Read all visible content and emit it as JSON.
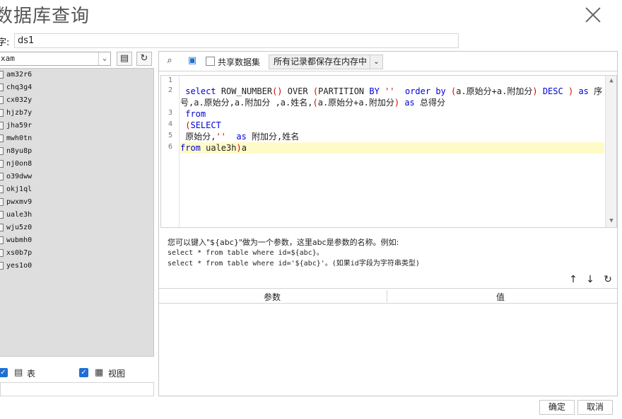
{
  "window": {
    "title": "数据库查询"
  },
  "name_field": {
    "label": "字:",
    "value": "ds1"
  },
  "left": {
    "datasource_value": "xam",
    "tables": [
      "am32r6",
      "chq3g4",
      "cx032y",
      "hjzb7y",
      "jha59r",
      "mwh0tn",
      "n8yu8p",
      "nj0on8",
      "o39dww",
      "okj1ql",
      "pwxmv9",
      "uale3h",
      "wju5z0",
      "wubmh0",
      "xs0b7p",
      "yes1o0"
    ],
    "options": {
      "table_label": "表",
      "view_label": "视图"
    }
  },
  "toolbar": {
    "share_label": "共享数据集",
    "mode_value": "所有记录都保存在内存中"
  },
  "editor": {
    "line_numbers": [
      "1",
      "2",
      "3",
      "4",
      "5",
      "6"
    ],
    "lines": [
      [],
      [
        {
          "t": " "
        },
        {
          "t": "select",
          "c": "kw"
        },
        {
          "t": " ROW_NUMBER"
        },
        {
          "t": "()",
          "c": "pn"
        },
        {
          "t": " OVER "
        },
        {
          "t": "(",
          "c": "pn"
        },
        {
          "t": "PARTITION "
        },
        {
          "t": "BY",
          "c": "kw"
        },
        {
          "t": " "
        },
        {
          "t": "''",
          "c": "pn"
        },
        {
          "t": "  "
        },
        {
          "t": "order by",
          "c": "kw"
        },
        {
          "t": " "
        },
        {
          "t": "(",
          "c": "pn"
        },
        {
          "t": "a.原始分+a.附加分"
        },
        {
          "t": ")",
          "c": "pn"
        },
        {
          "t": " "
        },
        {
          "t": "DESC",
          "c": "kw"
        },
        {
          "t": " "
        },
        {
          "t": ")",
          "c": "pn"
        },
        {
          "t": " "
        },
        {
          "t": "as",
          "c": "kw"
        },
        {
          "t": " 序"
        }
      ],
      [
        {
          "t": "号,a.原始分,a.附加分 ,a.姓名,"
        },
        {
          "t": "(",
          "c": "pn"
        },
        {
          "t": "a.原始分+a.附加分"
        },
        {
          "t": ")",
          "c": "pn"
        },
        {
          "t": " "
        },
        {
          "t": "as",
          "c": "kw"
        },
        {
          "t": " 总得分"
        }
      ],
      [
        {
          "t": " "
        },
        {
          "t": "from",
          "c": "kw"
        }
      ],
      [
        {
          "t": " "
        },
        {
          "t": "(",
          "c": "pn"
        },
        {
          "t": "SELECT",
          "c": "kw"
        }
      ],
      [
        {
          "t": " 原始分,"
        },
        {
          "t": "''",
          "c": "pn"
        },
        {
          "t": "  "
        },
        {
          "t": "as",
          "c": "kw"
        },
        {
          "t": " 附加分,姓名"
        }
      ],
      [
        {
          "t": "from",
          "c": "kw"
        },
        {
          "t": " uale3h"
        },
        {
          "t": ")",
          "c": "pn"
        },
        {
          "t": "a"
        }
      ]
    ]
  },
  "hint": {
    "line1": "您可以键入\"${abc}\"做为一个参数，这里abc是参数的名称。例如:",
    "line2": "select * from table where id=${abc}。",
    "line3": "select * from table where id='${abc}'。(如果id字段为字符串类型)"
  },
  "params": {
    "col_param": "参数",
    "col_value": "值"
  },
  "footer": {
    "ok_label": "确定",
    "cancel_label": "取消"
  }
}
